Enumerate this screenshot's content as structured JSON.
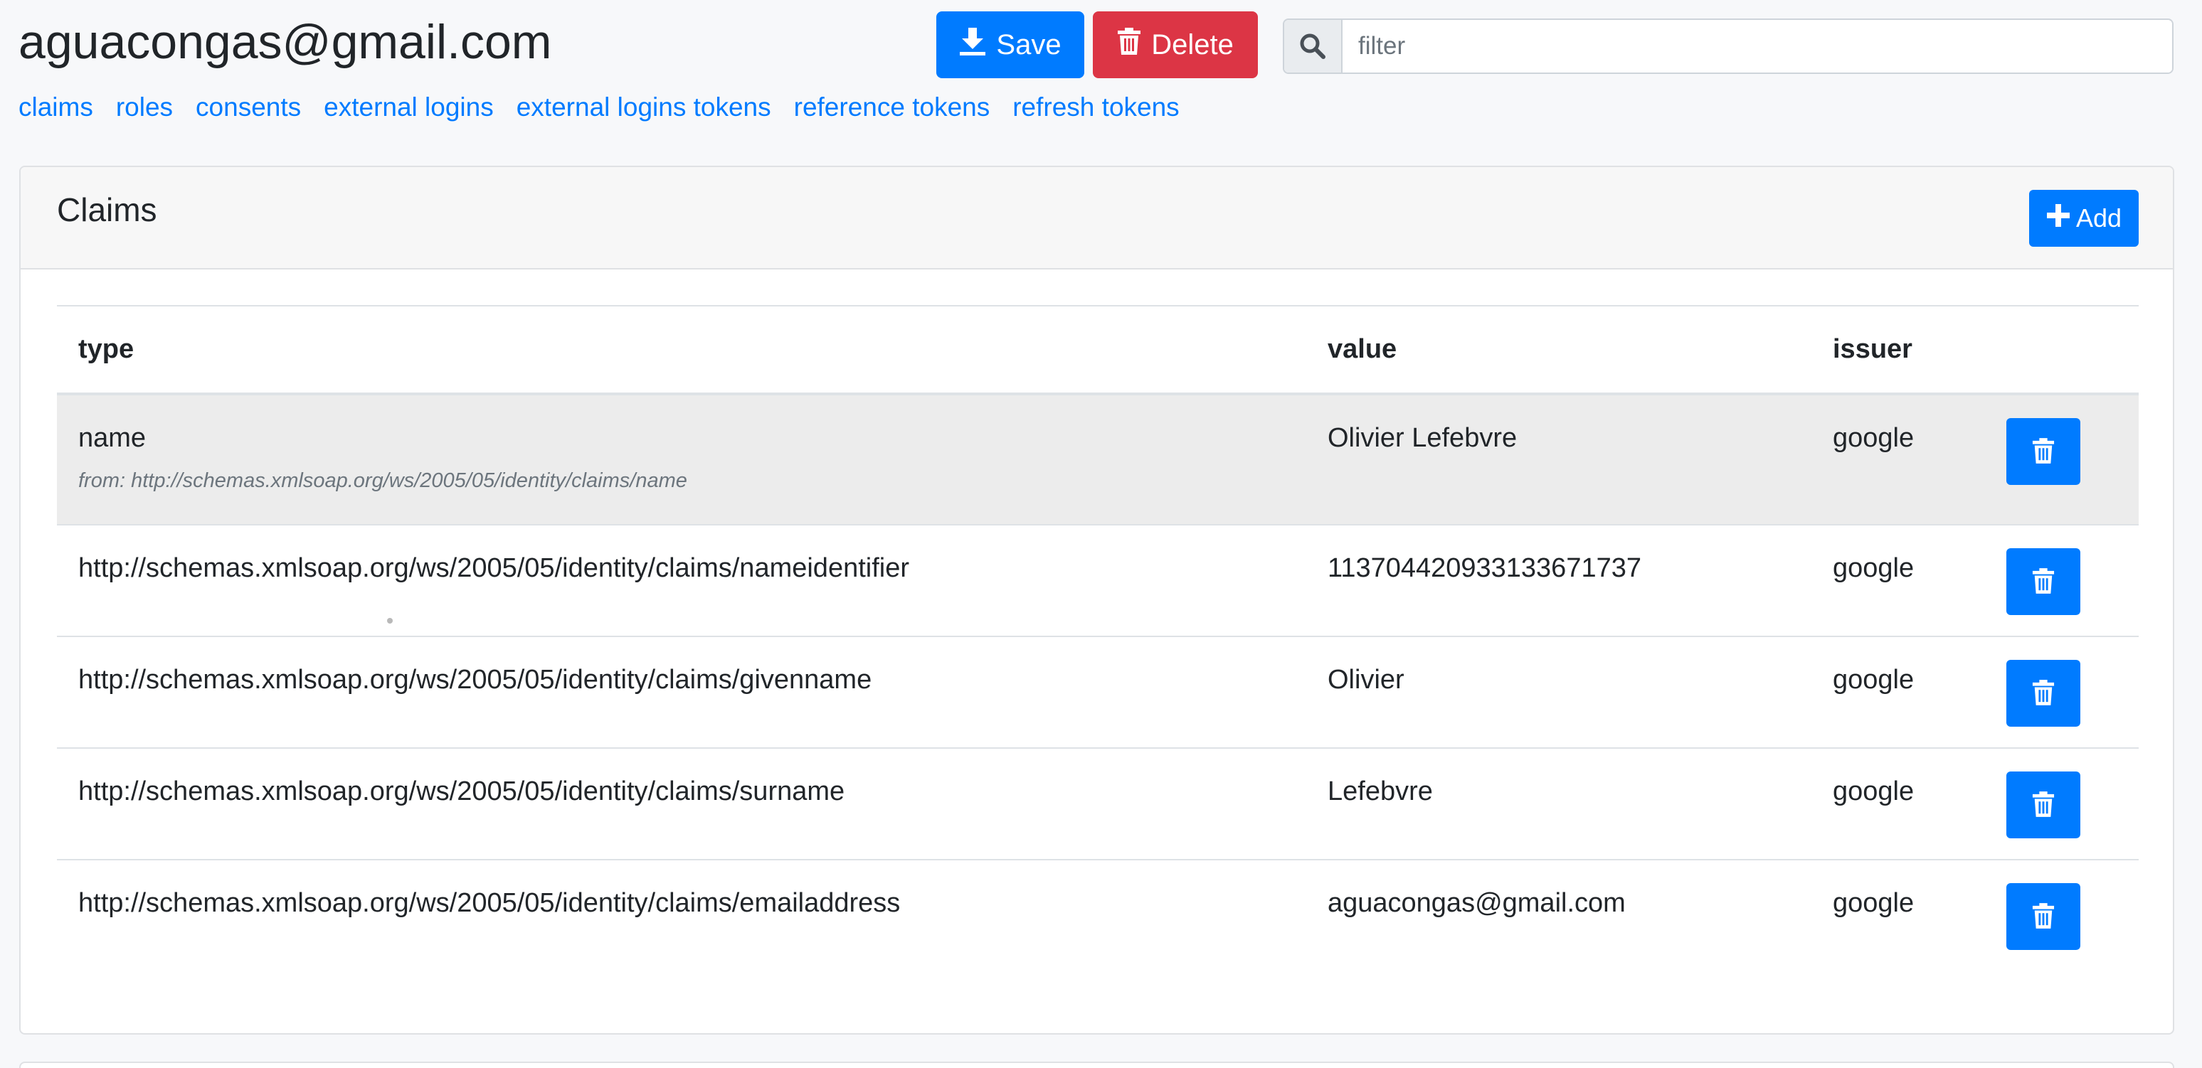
{
  "header": {
    "title": "aguacongas@gmail.com",
    "save_label": "Save",
    "delete_label": "Delete",
    "filter_placeholder": "filter"
  },
  "nav": {
    "links": [
      "claims",
      "roles",
      "consents",
      "external logins",
      "external logins tokens",
      "reference tokens",
      "refresh tokens"
    ]
  },
  "claims": {
    "title": "Claims",
    "add_label": "Add",
    "columns": [
      "type",
      "value",
      "issuer"
    ],
    "rows": [
      {
        "type": "name",
        "from": "from: http://schemas.xmlsoap.org/ws/2005/05/identity/claims/name",
        "value": "Olivier Lefebvre",
        "issuer": "google"
      },
      {
        "type": "http://schemas.xmlsoap.org/ws/2005/05/identity/claims/nameidentifier",
        "value": "113704420933133671737",
        "issuer": "google"
      },
      {
        "type": "http://schemas.xmlsoap.org/ws/2005/05/identity/claims/givenname",
        "value": "Olivier",
        "issuer": "google"
      },
      {
        "type": "http://schemas.xmlsoap.org/ws/2005/05/identity/claims/surname",
        "value": "Lefebvre",
        "issuer": "google"
      },
      {
        "type": "http://schemas.xmlsoap.org/ws/2005/05/identity/claims/emailaddress",
        "value": "aguacongas@gmail.com",
        "issuer": "google"
      }
    ]
  },
  "icons": {
    "save": "download-icon",
    "delete": "trash-icon",
    "filter": "search-icon",
    "add": "plus-icon"
  },
  "colors": {
    "primary": "#007bff",
    "danger": "#dc3545",
    "background": "#f7f8fa",
    "highlight_row": "#ececec"
  }
}
